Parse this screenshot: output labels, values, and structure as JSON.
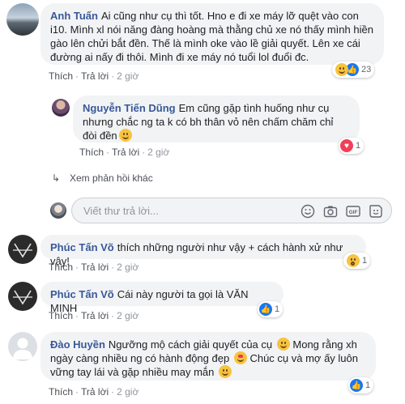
{
  "comments": [
    {
      "author": "Anh Tuấn",
      "text": "Ai cũng như cụ thì tốt. Hno e đi xe máy lỡ quệt vào con i10. Mình xl nói năng đàng hoàng mà thằng chủ xe nó thấy mình hiền gào lên chửi bắt đền. Thế là mình oke vào lề giải quyết. Lên xe cái đường ai nấy đi thôi. Mình đi xe máy nó tuổi lol đuổi đc.",
      "like": "Thích",
      "reply": "Trả lời",
      "time": "2 giờ",
      "reactions": "23"
    },
    {
      "author": "Nguyễn Tiến Dũng",
      "text": "Em cũng gặp tình huống như cụ nhưng chắc ng ta k có bh thân vỏ nên chấm chăm chỉ đòi đền",
      "like": "Thích",
      "reply": "Trả lời",
      "time": "2 giờ",
      "reactions": "1"
    },
    {
      "author": "Phúc Tấn Võ",
      "text": "thích những người như vậy + cách hành xử như vậy!",
      "like": "Thích",
      "reply": "Trả lời",
      "time": "2 giờ",
      "reactions": "1"
    },
    {
      "author": "Phúc Tấn Võ",
      "text": "Cái này người ta gọi là VĂN MINH",
      "like": "Thích",
      "reply": "Trả lời",
      "time": "2 giờ",
      "reactions": "1"
    },
    {
      "author": "Đào Huyền",
      "text_a": "Ngưỡng mộ cách giải quyết của cụ",
      "text_b": "Mong rằng xh ngày càng nhiều ng có hành động đẹp",
      "text_c": "Chúc cụ và mợ ấy luôn vững tay lái và gặp nhiều may mắn",
      "like": "Thích",
      "reply": "Trả lời",
      "time": "2 giờ",
      "reactions": "1"
    }
  ],
  "more_replies": "Xem phản hồi khác",
  "reply_box": {
    "placeholder": "Viết thư trả lời..."
  },
  "icons": [
    "smiley-icon",
    "camera-icon",
    "gif-icon",
    "sticker-icon"
  ],
  "colors": {
    "link": "#385898",
    "like": "#1877f2",
    "heart": "#f33e58",
    "bubble": "#f2f3f5"
  }
}
